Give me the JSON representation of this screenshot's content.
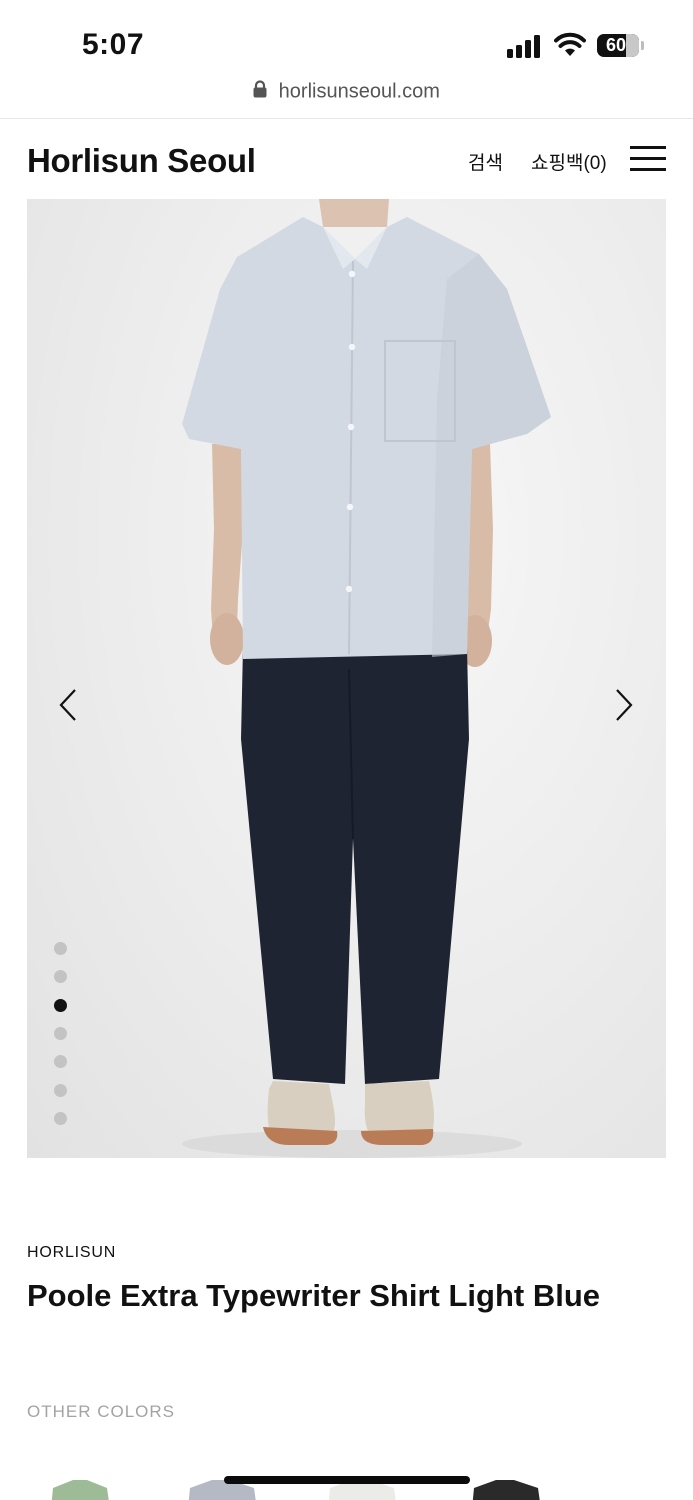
{
  "status_bar": {
    "time": "5:07",
    "battery": "60"
  },
  "browser": {
    "url": "horlisunseoul.com"
  },
  "header": {
    "logo": "Horlisun Seoul",
    "search_label": "검색",
    "bag_label": "쇼핑백(0)"
  },
  "gallery": {
    "image_count": 7,
    "active_index": 3
  },
  "product": {
    "brand": "HORLISUN",
    "title": "Poole Extra Typewriter Shirt Light Blue",
    "other_colors_label": "OTHER COLORS",
    "swatches": [
      "green",
      "light-blue",
      "white",
      "black"
    ]
  },
  "colors": {
    "text": "#111111",
    "muted": "#a3a3a3",
    "dot_inactive": "#c3c3c3",
    "dot_active": "#111111"
  }
}
